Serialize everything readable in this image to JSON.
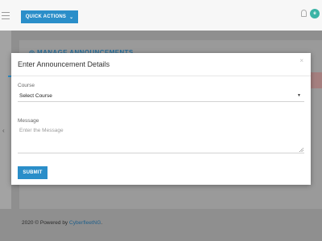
{
  "header": {
    "quick_actions_label": "QUICK ACTIONS",
    "quick_actions_caret": "⌄",
    "user_initial": "e"
  },
  "page": {
    "section_title": "◎ MANAGE ANNOUNCEMENTS"
  },
  "modal": {
    "title": "Enter Announcement Details",
    "close_glyph": "×",
    "course_label": "Course",
    "course_selected": "Select Course",
    "select_arrow": "▼",
    "message_label": "Message",
    "message_placeholder": "Enter the Message",
    "submit_label": "SUBMIT"
  },
  "footer": {
    "prefix": "2020 © Powered by ",
    "link_text": "CyberfleetNG",
    "suffix": "."
  },
  "colors": {
    "accent": "#2a8ec9",
    "badge": "#3bb4a6",
    "overlay": "#8f8f8f"
  },
  "sidebar": {
    "collapse_glyph": "‹"
  }
}
